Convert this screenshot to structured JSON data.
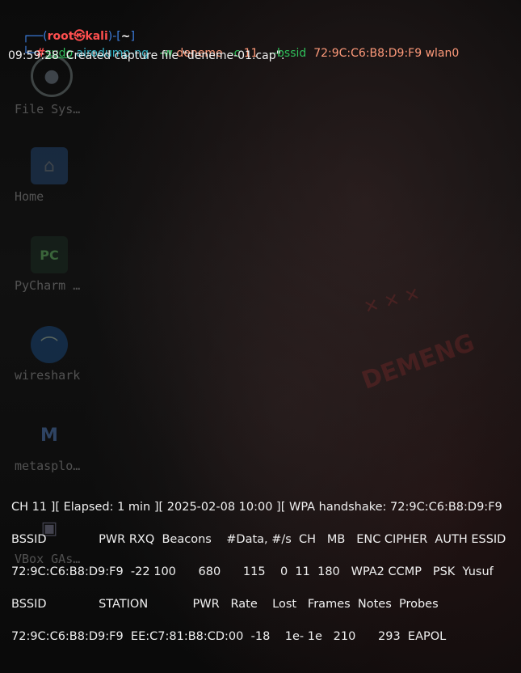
{
  "prompt": {
    "user": "root",
    "skull": "㉿",
    "host": "kali",
    "dir": "~",
    "hash": "#",
    "sudo": "sudo",
    "cmd": "airodump-ng",
    "flag_w": "-w",
    "val_w": "deneme",
    "flag_c": "-c",
    "val_c": "11",
    "flag_bssid": "--bssid",
    "val_bssid": "72:9C:C6:B8:D9:F9",
    "iface": "wlan0"
  },
  "output": {
    "capture_line": "09:59:28  Created capture file \"deneme-01.cap\".",
    "status_line": "CH 11 ][ Elapsed: 1 min ][ 2025-02-08 10:00 ][ WPA handshake: 72:9C:C6:B8:D9:F9",
    "ap_header": "BSSID              PWR RXQ  Beacons    #Data, #/s  CH   MB   ENC CIPHER  AUTH ESSID",
    "ap_row": "72:9C:C6:B8:D9:F9  -22 100      680      115    0  11  180   WPA2 CCMP   PSK  Yusuf",
    "sta_header": "BSSID              STATION            PWR   Rate    Lost   Frames  Notes  Probes",
    "sta_row": "72:9C:C6:B8:D9:F9  EE:C7:81:B8:CD:00  -18    1e- 1e   210      293  EAPOL"
  },
  "desktop": {
    "icons": [
      {
        "label": "File Sys…",
        "icon": "disk-icon"
      },
      {
        "label": "Home",
        "icon": "home-folder-icon"
      },
      {
        "label": "PyCharm …",
        "icon": "pycharm-icon"
      },
      {
        "label": "wireshark",
        "icon": "wireshark-icon"
      },
      {
        "label": "metasplo…",
        "icon": "metasploit-icon"
      },
      {
        "label": "VBox GAs…",
        "icon": "vbox-icon"
      }
    ]
  }
}
